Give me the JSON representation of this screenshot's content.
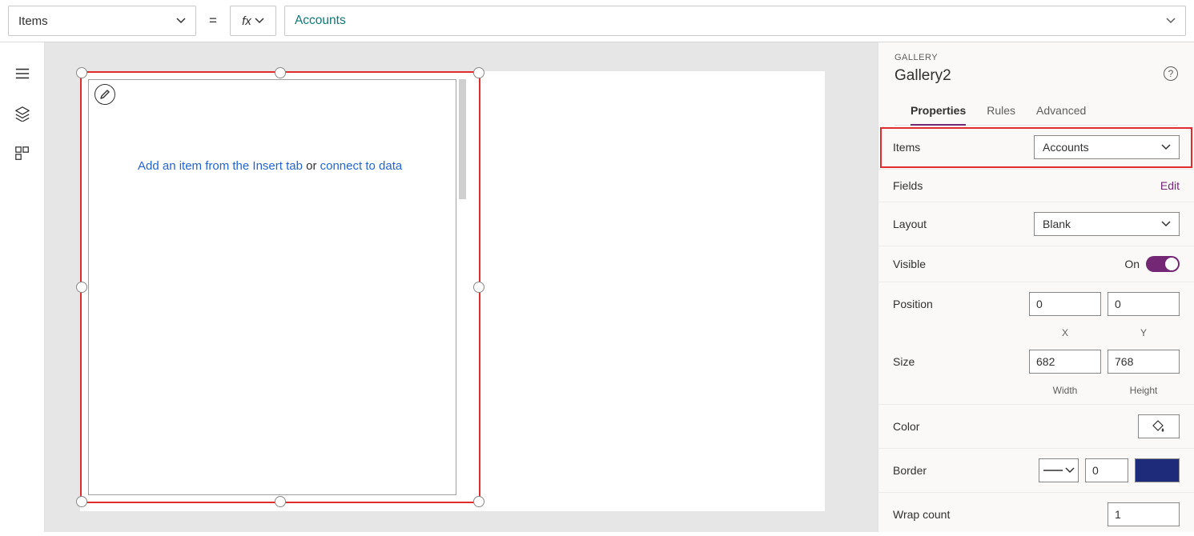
{
  "formulaBar": {
    "propertyName": "Items",
    "equals": "=",
    "fxLabel": "fx",
    "formula": "Accounts"
  },
  "canvas": {
    "hintPrefix": "Add an item from the Insert tab",
    "hintMid": " or ",
    "hintLink": "connect to data"
  },
  "panel": {
    "typeLabel": "GALLERY",
    "controlName": "Gallery2",
    "tabs": {
      "properties": "Properties",
      "rules": "Rules",
      "advanced": "Advanced"
    },
    "items": {
      "label": "Items",
      "value": "Accounts"
    },
    "fields": {
      "label": "Fields",
      "edit": "Edit"
    },
    "layout": {
      "label": "Layout",
      "value": "Blank"
    },
    "visible": {
      "label": "Visible",
      "state": "On"
    },
    "position": {
      "label": "Position",
      "x": "0",
      "y": "0",
      "xLabel": "X",
      "yLabel": "Y"
    },
    "size": {
      "label": "Size",
      "w": "682",
      "h": "768",
      "wLabel": "Width",
      "hLabel": "Height"
    },
    "color": {
      "label": "Color"
    },
    "border": {
      "label": "Border",
      "width": "0"
    },
    "wrap": {
      "label": "Wrap count",
      "value": "1"
    }
  }
}
